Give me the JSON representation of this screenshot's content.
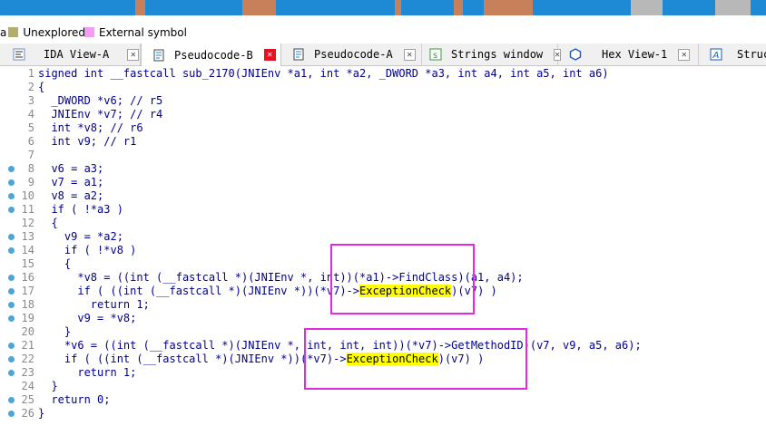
{
  "navband": {
    "colors": [
      "#1e8ad6",
      "#c8805a",
      "#1e8ad6",
      "#c8805a",
      "#1e8ad6",
      "#c8805a",
      "#1e8ad6",
      "#c8805a",
      "#1e8ad6",
      "#c8805a",
      "#1e8ad6",
      "#b8b8b8",
      "#1e8ad6",
      "#b8b8b8",
      "#1e8ad6"
    ]
  },
  "legend": {
    "items": [
      {
        "label": "Unexplored",
        "color": "#b5ad6e"
      },
      {
        "label": "External symbol",
        "color": "#f59cf5"
      }
    ]
  },
  "tabs": [
    {
      "label": "IDA View-A",
      "icon": "ida-view-icon",
      "active": false
    },
    {
      "label": "Pseudocode-B",
      "icon": "pseudocode-icon",
      "active": true
    },
    {
      "label": "Pseudocode-A",
      "icon": "pseudocode-icon",
      "active": false
    },
    {
      "label": "Strings window",
      "icon": "strings-icon",
      "active": false
    },
    {
      "label": "Hex View-1",
      "icon": "hex-view-icon",
      "active": false
    },
    {
      "label": "Struc",
      "icon": "structures-icon",
      "active": false
    }
  ],
  "code": {
    "lines": [
      {
        "n": "1",
        "bp": false,
        "text": "signed int __fastcall sub_2170(JNIEnv *a1, int *a2, _DWORD *a3, int a4, int a5, int a6)"
      },
      {
        "n": "2",
        "bp": false,
        "text": "{"
      },
      {
        "n": "3",
        "bp": false,
        "text": "  _DWORD *v6; // r5"
      },
      {
        "n": "4",
        "bp": false,
        "text": "  JNIEnv *v7; // r4"
      },
      {
        "n": "5",
        "bp": false,
        "text": "  int *v8; // r6"
      },
      {
        "n": "6",
        "bp": false,
        "text": "  int v9; // r1"
      },
      {
        "n": "7",
        "bp": false,
        "text": ""
      },
      {
        "n": "8",
        "bp": true,
        "text": "  v6 = a3;"
      },
      {
        "n": "9",
        "bp": true,
        "text": "  v7 = a1;"
      },
      {
        "n": "10",
        "bp": true,
        "text": "  v8 = a2;"
      },
      {
        "n": "11",
        "bp": true,
        "text": "  if ( !*a3 )"
      },
      {
        "n": "12",
        "bp": false,
        "text": "  {"
      },
      {
        "n": "13",
        "bp": true,
        "text": "    v9 = *a2;"
      },
      {
        "n": "14",
        "bp": true,
        "text": "    if ( !*v8 )"
      },
      {
        "n": "15",
        "bp": false,
        "text": "    {"
      },
      {
        "n": "16",
        "bp": true,
        "text": "      *v8 = ((int (__fastcall *)(JNIEnv *, int))(*a1)->FindClass)(a1, a4);"
      },
      {
        "n": "17",
        "bp": true,
        "text": "      if ( ((int (__fastcall *)(JNIEnv *))(*v7)->ExceptionCheck)(v7) )",
        "hl": "ExceptionCheck"
      },
      {
        "n": "18",
        "bp": true,
        "text": "        return 1;"
      },
      {
        "n": "19",
        "bp": true,
        "text": "      v9 = *v8;"
      },
      {
        "n": "20",
        "bp": false,
        "text": "    }"
      },
      {
        "n": "21",
        "bp": true,
        "text": "    *v6 = ((int (__fastcall *)(JNIEnv *, int, int, int))(*v7)->GetMethodID)(v7, v9, a5, a6);"
      },
      {
        "n": "22",
        "bp": true,
        "text": "    if ( ((int (__fastcall *)(JNIEnv *))(*v7)->ExceptionCheck)(v7) )",
        "hl": "ExceptionCheck"
      },
      {
        "n": "23",
        "bp": true,
        "text": "      return 1;"
      },
      {
        "n": "24",
        "bp": false,
        "text": "  }"
      },
      {
        "n": "25",
        "bp": true,
        "text": "  return 0;"
      },
      {
        "n": "26",
        "bp": true,
        "text": "}"
      }
    ]
  }
}
